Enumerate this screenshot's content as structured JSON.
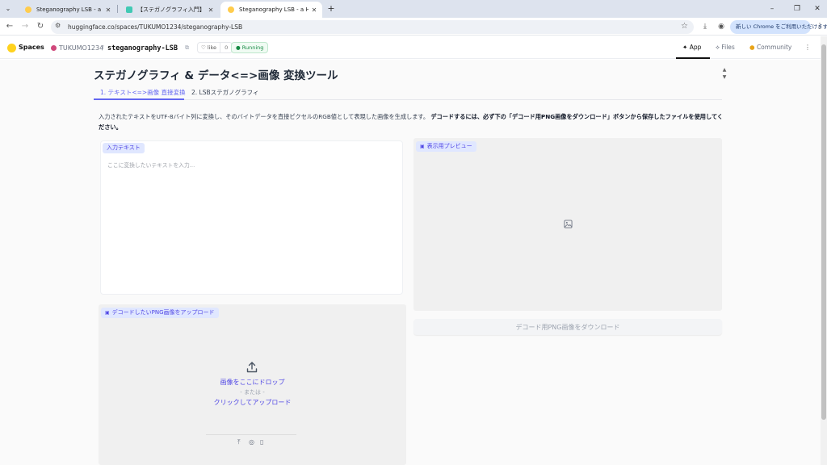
{
  "browser": {
    "tabs": [
      {
        "title": "Steganography LSB - a Hugging",
        "favicon": "huggingface-icon",
        "active": false
      },
      {
        "title": "【ステガノグラフィ入門】#4 スパイ秘",
        "favicon": "note-icon",
        "active": false
      },
      {
        "title": "Steganography LSB - a Huggi",
        "favicon": "huggingface-icon",
        "active": true
      }
    ],
    "url": "huggingface.co/spaces/TUKUMO1234/steganography-LSB",
    "chrome_notice": "新しい Chrome をご利用いただけます"
  },
  "hf_header": {
    "spaces_label": "Spaces",
    "owner": "TUKUMO1234",
    "repo": "steganography-LSB",
    "like_label": "like",
    "like_count": "0",
    "status": "Running",
    "nav": [
      {
        "label": "App",
        "active": true
      },
      {
        "label": "Files",
        "active": false
      },
      {
        "label": "Community",
        "active": false
      }
    ]
  },
  "app": {
    "title": "ステガノグラフィ & データ<=>画像 変換ツール",
    "tabs": [
      {
        "label": "1. テキスト<=>画像 直接変換",
        "active": true
      },
      {
        "label": "2. LSBステガノグラフィ",
        "active": false
      }
    ],
    "description_normal": "入力されたテキストをUTF-8バイト列に変換し、そのバイトデータを直接ピクセルのRGB値として表現した画像を生成します。",
    "description_bold": "デコードするには、必ず下の「デコード用PNG画像をダウンロード」ボタンから保存したファイルを使用してください。",
    "input": {
      "label": "入力テキスト",
      "placeholder": "ここに変換したいテキストを入力...",
      "value": ""
    },
    "upload": {
      "label": "デコードしたいPNG画像をアップロード",
      "drop_text": "画像をここにドロップ",
      "or_text": "- または -",
      "click_text": "クリックしてアップロード"
    },
    "preview": {
      "label": "表示用プレビュー"
    },
    "download_button": "デコード用PNG画像をダウンロード"
  },
  "colors": {
    "accent": "#6366f1",
    "label_bg": "#e0e7ff",
    "running": "#168a43"
  }
}
